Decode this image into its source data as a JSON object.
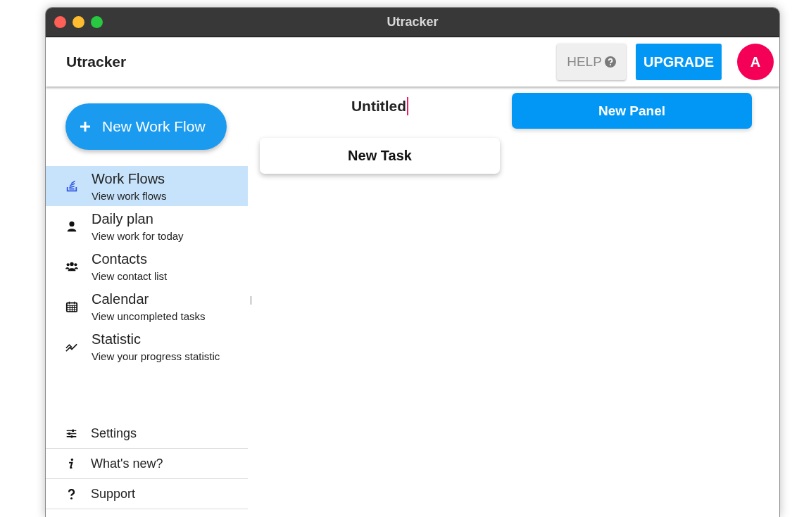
{
  "window": {
    "title": "Utracker"
  },
  "header": {
    "app_name": "Utracker",
    "help_button": "HELP",
    "upgrade_button": "UPGRADE",
    "avatar": "A"
  },
  "sidebar": {
    "new_button": "New Work Flow",
    "items": [
      {
        "title": "Work Flows",
        "subtitle": "View work flows",
        "selected": true
      },
      {
        "title": "Daily plan",
        "subtitle": "View work for today",
        "selected": false
      },
      {
        "title": "Contacts",
        "subtitle": "View contact list",
        "selected": false
      },
      {
        "title": "Calendar",
        "subtitle": "View uncompleted tasks",
        "selected": false
      },
      {
        "title": "Statistic",
        "subtitle": "View your progress statistic",
        "selected": false
      }
    ],
    "footer_items": [
      {
        "label": "Settings"
      },
      {
        "label": "What's new?"
      },
      {
        "label": "Support"
      }
    ]
  },
  "board": {
    "title_field": {
      "value": "Untitled",
      "focused": true
    },
    "new_task_button": "New Task",
    "new_panel_button": "New Panel"
  }
}
